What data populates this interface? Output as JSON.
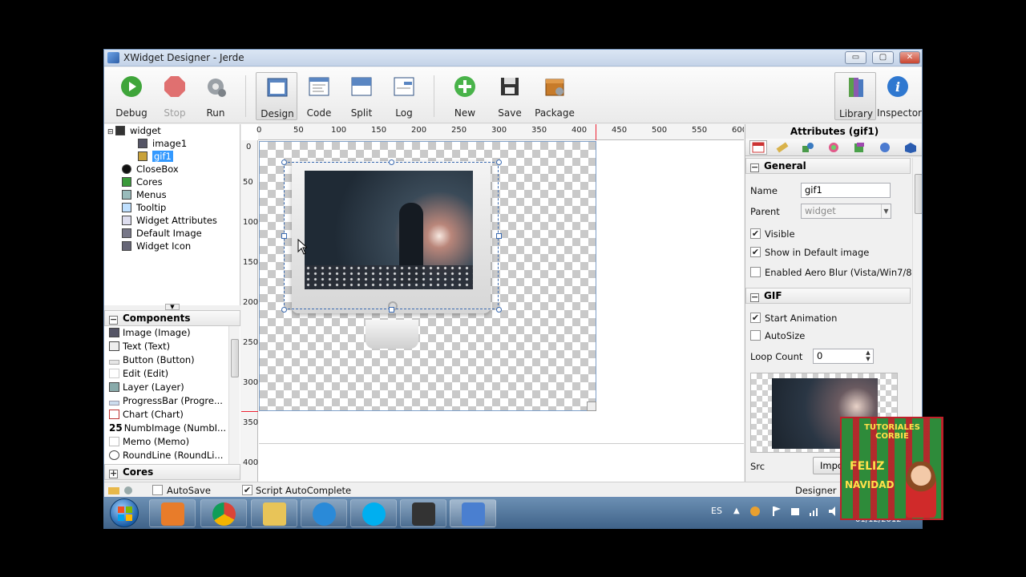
{
  "window": {
    "title": "XWidget Designer - Jerde",
    "minimize": "▭",
    "maximize": "▢",
    "close": "✕"
  },
  "toolbar": {
    "debug": "Debug",
    "stop": "Stop",
    "run": "Run",
    "design": "Design",
    "code": "Code",
    "split": "Split",
    "log": "Log",
    "new": "New",
    "save": "Save",
    "package": "Package",
    "library": "Library",
    "inspector": "Inspector"
  },
  "tree": {
    "items": [
      {
        "label": "widget"
      },
      {
        "label": "image1"
      },
      {
        "label": "gif1"
      },
      {
        "label": "CloseBox"
      },
      {
        "label": "Cores"
      },
      {
        "label": "Menus"
      },
      {
        "label": "Tooltip"
      },
      {
        "label": "Widget Attributes"
      },
      {
        "label": "Default Image"
      },
      {
        "label": "Widget Icon"
      }
    ]
  },
  "components": {
    "title": "Components",
    "items": [
      {
        "label": "Image (Image)"
      },
      {
        "label": "Text (Text)"
      },
      {
        "label": "Button (Button)"
      },
      {
        "label": "Edit (Edit)"
      },
      {
        "label": "Layer (Layer)"
      },
      {
        "label": "ProgressBar (Progre..."
      },
      {
        "label": "Chart (Chart)"
      },
      {
        "label": "NumbImage (NumbI..."
      },
      {
        "label": "Memo (Memo)"
      },
      {
        "label": "RoundLine (RoundLi..."
      }
    ],
    "numb_icon": "25"
  },
  "cores_section": "Cores",
  "ruler": {
    "h": [
      "0",
      "50",
      "100",
      "150",
      "200",
      "250",
      "300",
      "350",
      "400",
      "450",
      "500",
      "550",
      "600"
    ],
    "v": [
      "0",
      "50",
      "100",
      "150",
      "200",
      "250",
      "300",
      "350",
      "400"
    ]
  },
  "attributes": {
    "title": "Attributes (gif1)",
    "general_title": "General",
    "name_label": "Name",
    "name_value": "gif1",
    "parent_label": "Parent",
    "parent_value": "widget",
    "visible": "Visible",
    "show_default": "Show in Default image",
    "aero_blur": "Enabled Aero Blur (Vista/Win7/8)",
    "gif_title": "GIF",
    "start_animation": "Start Animation",
    "autosize": "AutoSize",
    "loop_label": "Loop Count",
    "loop_value": "0",
    "src_label": "Src",
    "import_label": "Impor"
  },
  "status": {
    "autosave": "AutoSave",
    "script_autocomplete": "Script AutoComplete",
    "right_text": "Designer ba"
  },
  "taskbar": {
    "lang": "ES",
    "date": "01/12/2012"
  },
  "overlay": {
    "line1": "TUTORIALES CORBIE",
    "line2": "FELIZ",
    "line3": "NAVIDAD"
  },
  "colors": {
    "accent": "#3399ff",
    "taskbar": "#4e7299",
    "overlay_green": "#2e8b3a",
    "overlay_red": "#c0202a"
  }
}
